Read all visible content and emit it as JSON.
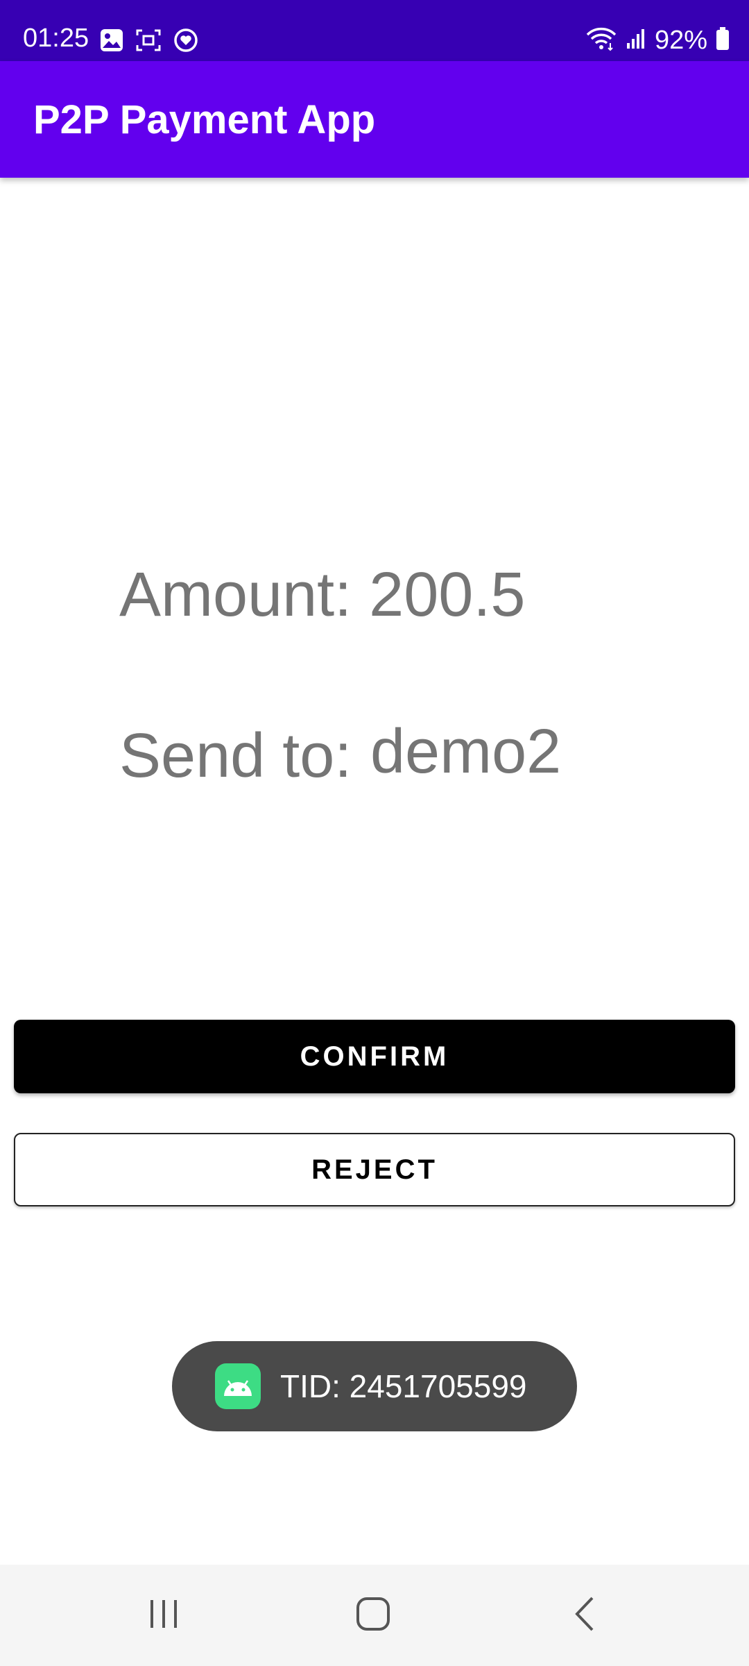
{
  "status_bar": {
    "time": "01:25",
    "battery": "92%",
    "icons_left": [
      "image-icon",
      "screenshot-icon",
      "health-icon"
    ],
    "icons_right": [
      "wifi-icon",
      "signal-icon",
      "battery-icon"
    ]
  },
  "app_bar": {
    "title": "P2P Payment App"
  },
  "content": {
    "amount_text": "Amount: 200.5",
    "send_to_label": "Send to:",
    "send_to_value": "demo2"
  },
  "buttons": {
    "confirm_label": "CONFIRM",
    "reject_label": "REJECT"
  },
  "toast": {
    "text": "TID: 2451705599",
    "icon": "android-icon"
  },
  "nav_bar": {
    "icons": [
      "recents-icon",
      "home-icon",
      "back-icon"
    ]
  },
  "colors": {
    "status_bar": "#3700b3",
    "app_bar": "#6200ee",
    "content_text": "#757575",
    "confirm_bg": "#000000",
    "toast_bg": "#4a4a4a",
    "android_green": "#3ddc84"
  }
}
